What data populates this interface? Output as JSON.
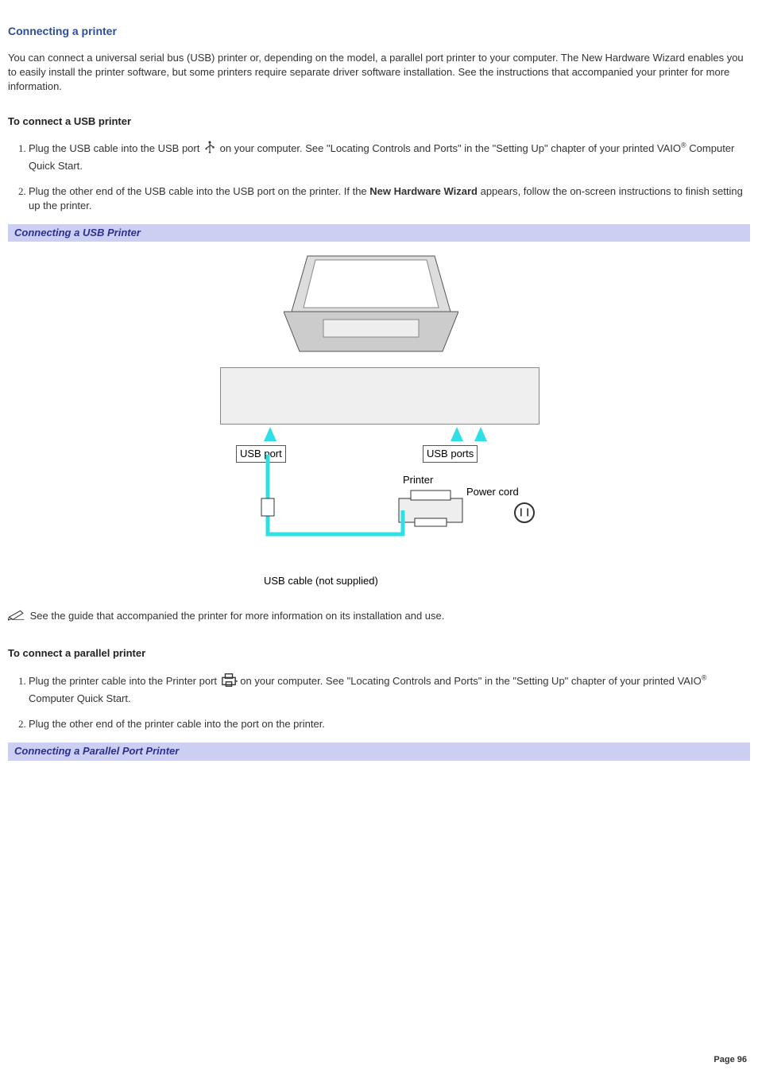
{
  "title": "Connecting a printer",
  "intro": "You can connect a universal serial bus (USB) printer or, depending on the model, a parallel port printer to your computer. The New Hardware Wizard enables you to easily install the printer software, but some printers require separate driver software installation. See the instructions that accompanied your printer for more information.",
  "usb": {
    "heading": "To connect a USB printer",
    "step1a": "Plug the USB cable into the USB port ",
    "step1b": " on your computer. See \"Locating Controls and Ports\" in the \"Setting Up\" chapter of your printed VAIO",
    "step1c": " Computer Quick Start.",
    "step2a": "Plug the other end of the USB cable into the USB port on the printer. If the ",
    "step2bold": "New Hardware Wizard",
    "step2b": " appears, follow the on-screen instructions to finish setting up the printer.",
    "caption": "Connecting a USB Printer"
  },
  "figure": {
    "usb_port_single": "USB port",
    "usb_ports": "USB ports",
    "printer": "Printer",
    "power_cord": "Power cord",
    "usb_cable": "USB cable (not supplied)"
  },
  "note": "See the guide that accompanied the printer for more information on its installation and use.",
  "parallel": {
    "heading": "To connect a parallel printer",
    "step1a": "Plug the printer cable into the Printer port ",
    "step1b": " on your computer. See \"Locating Controls and Ports\" in the \"Setting Up\" chapter of your printed VAIO",
    "step1c": " Computer Quick Start.",
    "step2": "Plug the other end of the printer cable into the port on the printer.",
    "caption": "Connecting a Parallel Port Printer"
  },
  "reg": "®",
  "page_footer": "Page 96"
}
